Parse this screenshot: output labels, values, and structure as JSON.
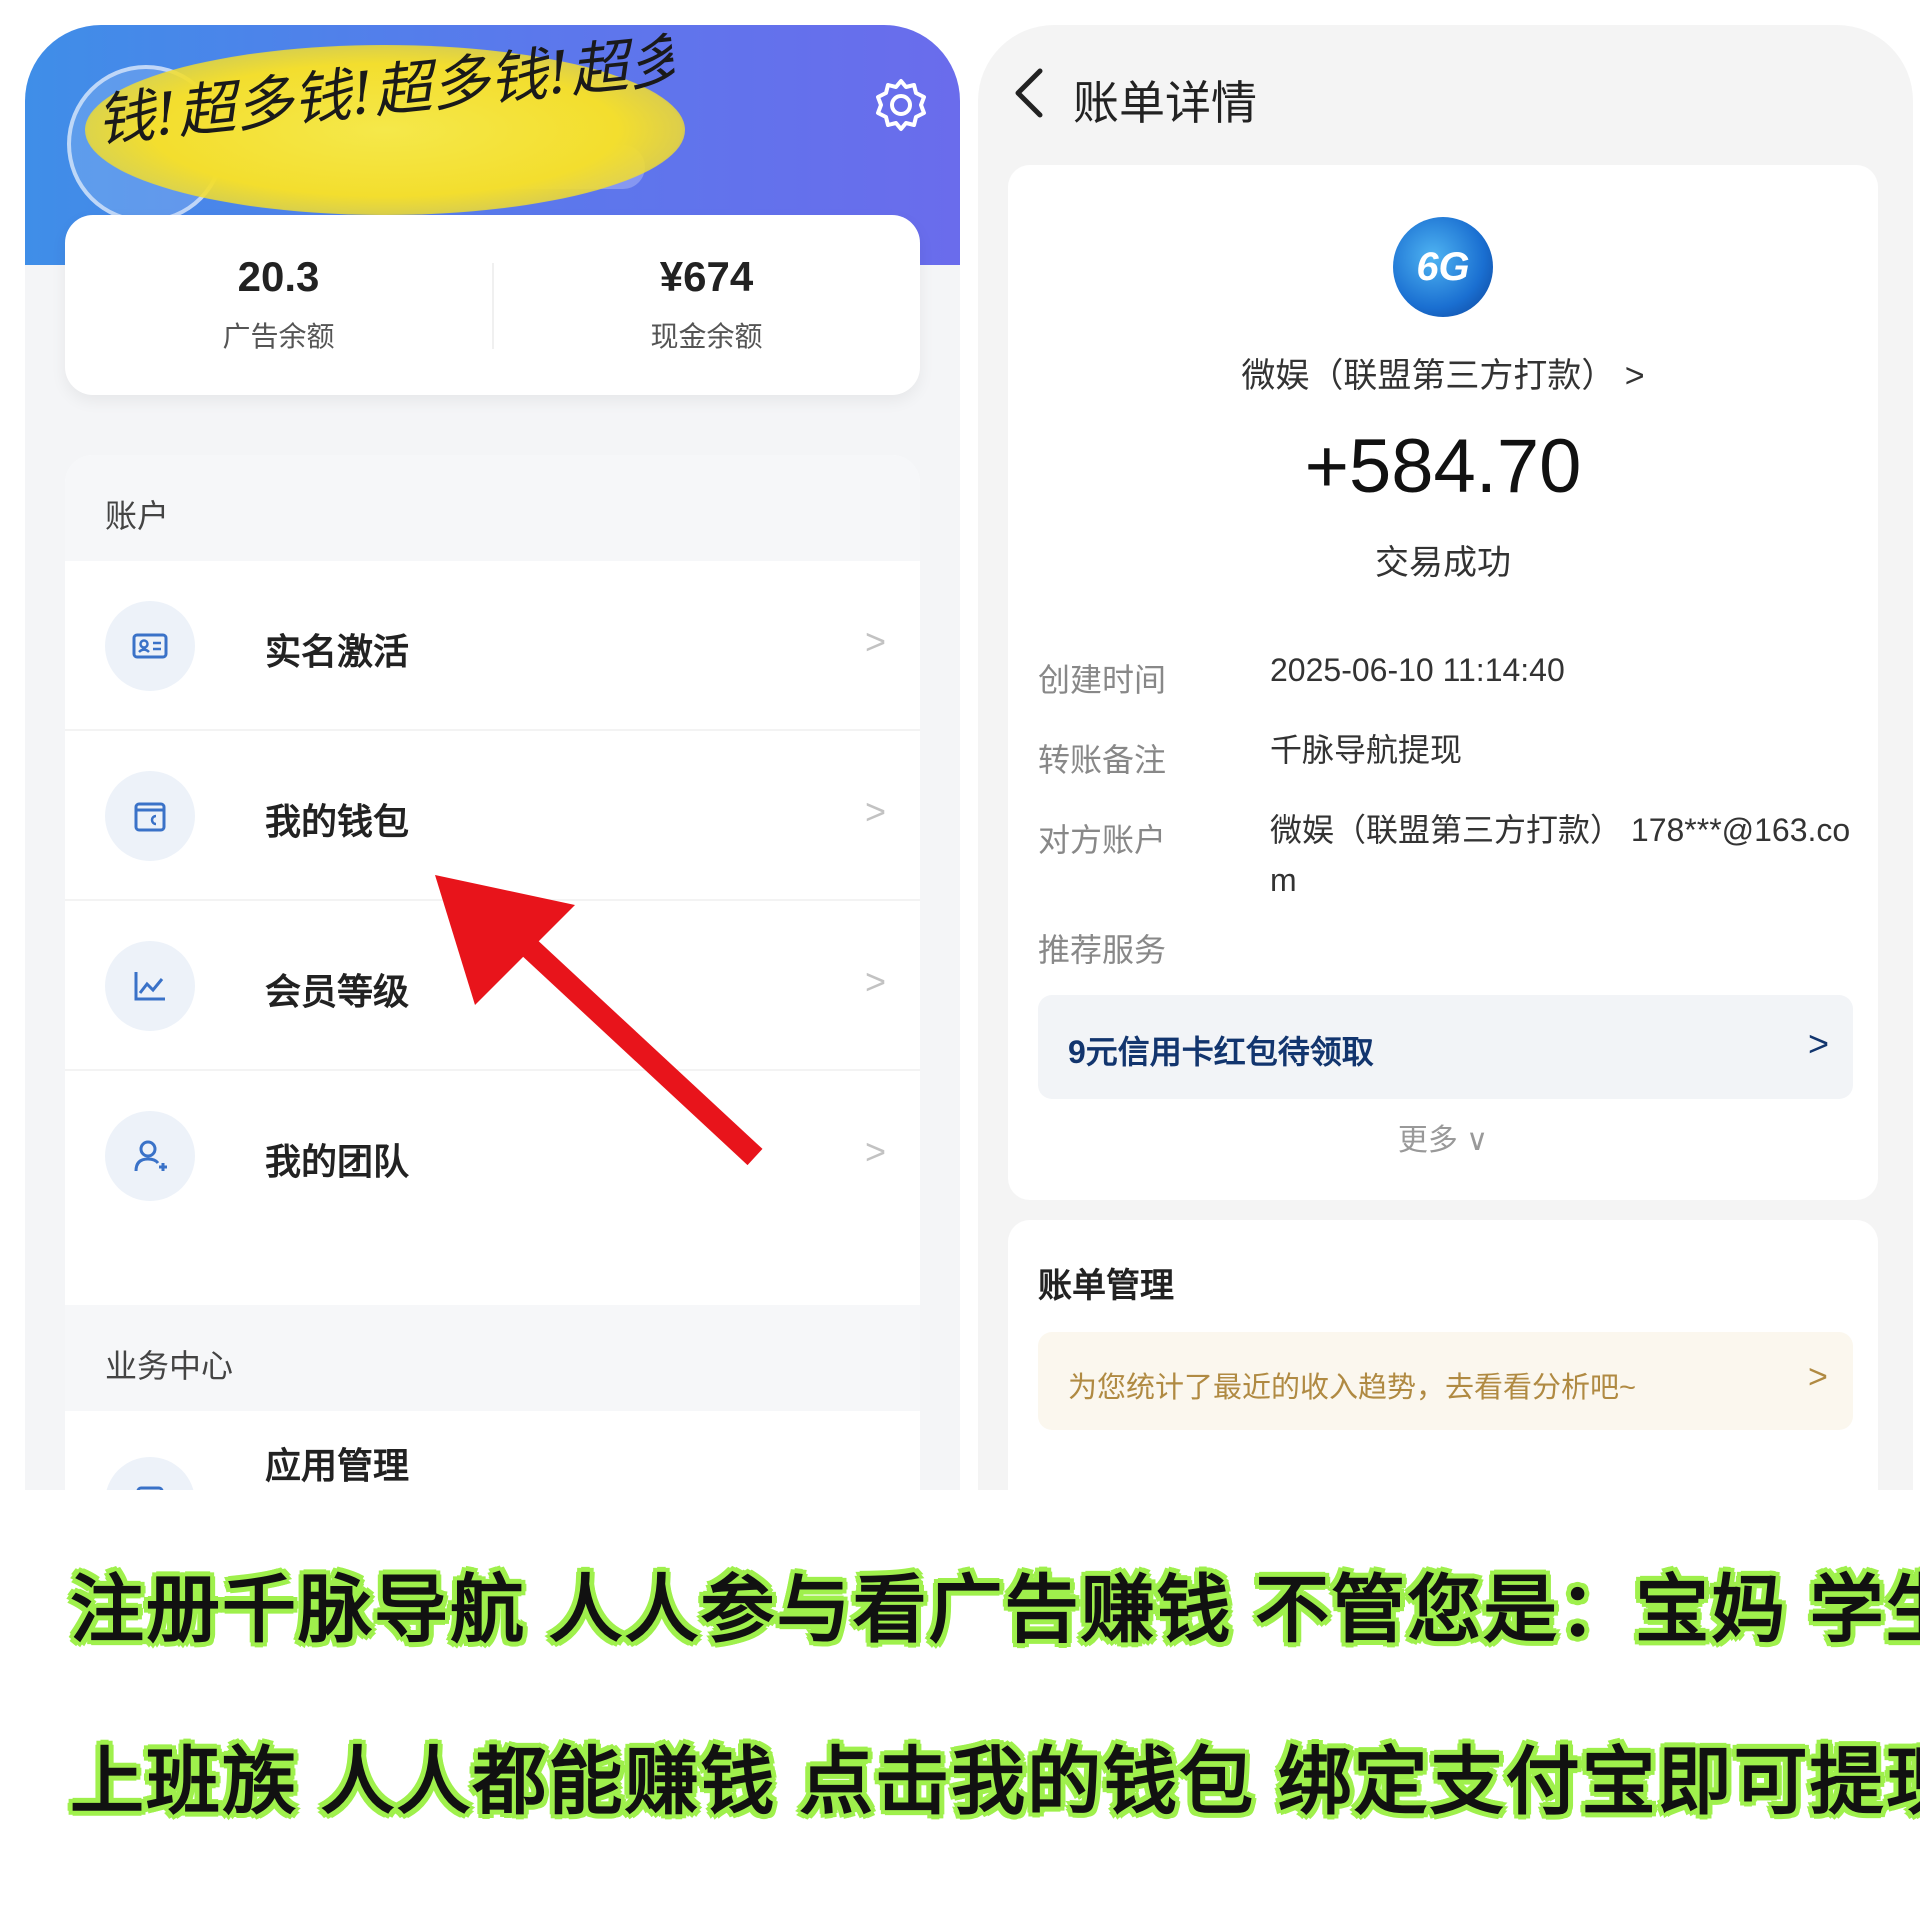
{
  "left": {
    "watermark": "钱!超多钱!超多钱!超多钱!超",
    "balances": [
      {
        "value": "20.3",
        "label": "广告余额"
      },
      {
        "value": "¥674",
        "label": "现金余额"
      }
    ],
    "account_section": "账户",
    "account_items": [
      {
        "label": "实名激活",
        "icon": "id-card-icon"
      },
      {
        "label": "我的钱包",
        "icon": "wallet-icon"
      },
      {
        "label": "会员等级",
        "icon": "chart-icon"
      },
      {
        "label": "我的团队",
        "icon": "user-add-icon"
      }
    ],
    "business_section": "业务中心",
    "business_items": [
      {
        "label": "应用管理",
        "icon": "app-icon"
      }
    ],
    "chevron": ">"
  },
  "right": {
    "title": "账单详情",
    "merchant": "微娱（联盟第三方打款） >",
    "logo_text": "6G",
    "amount": "+584.70",
    "status": "交易成功",
    "details": [
      {
        "label": "创建时间",
        "value": "2025-06-10 11:14:40"
      },
      {
        "label": "转账备注",
        "value": "千脉导航提现"
      },
      {
        "label": "对方账户",
        "value": "微娱（联盟第三方打款） 178***@163.com"
      }
    ],
    "recommend_label": "推荐服务",
    "promo": "9元信用卡红包待领取",
    "more": "更多 ∨",
    "management_title": "账单管理",
    "trend_text": "为您统计了最近的收入趋势，去看看分析吧~",
    "chevron": ">"
  },
  "caption": {
    "line1": "注册千脉导航 人人参与看广告赚钱 不管您是：宝妈 学生",
    "line2": "上班族 人人都能赚钱 点击我的钱包 绑定支付宝即可提现"
  },
  "colors": {
    "header_gradient_start": "#3f8ee8",
    "header_gradient_end": "#6a6cec",
    "arrow": "#e8141b",
    "caption_outline": "#9ff04c",
    "promo_text": "#12356e",
    "trend_text": "#b08a42"
  }
}
